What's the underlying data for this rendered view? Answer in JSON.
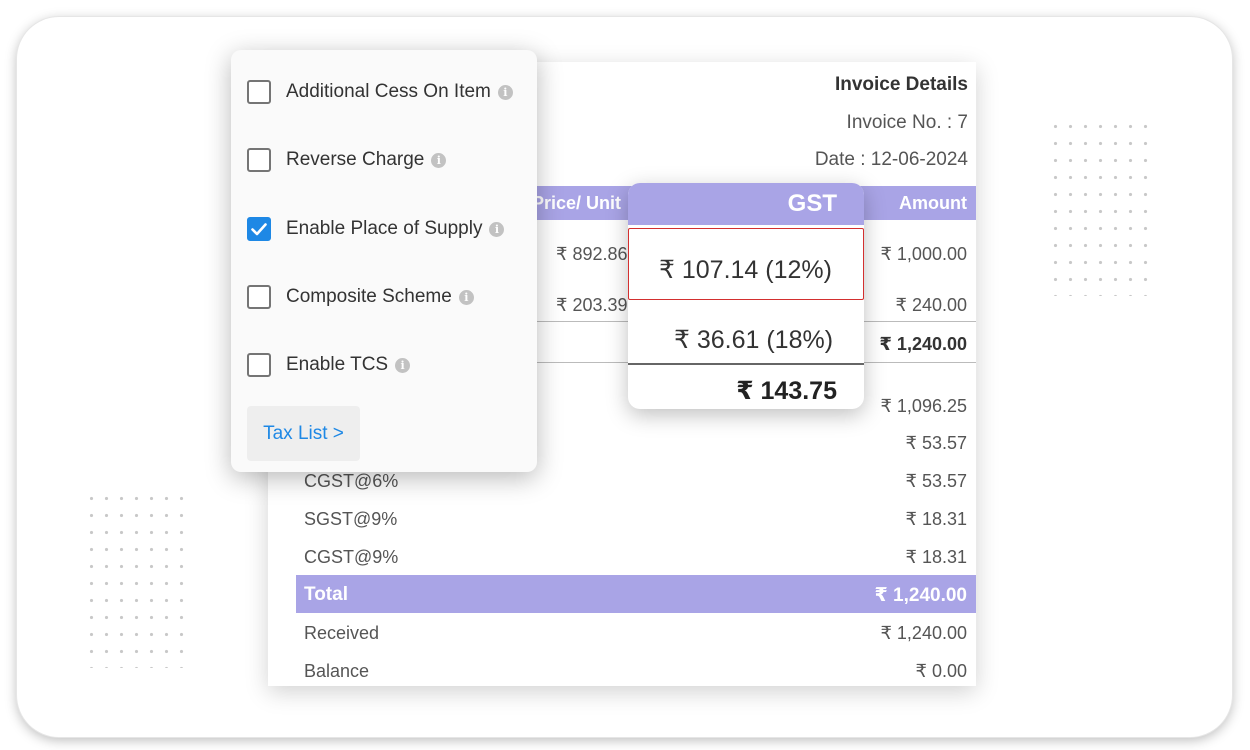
{
  "invoice": {
    "title": "Invoice Details",
    "number": "Invoice No. : 7",
    "date": "Date : 12-06-2024",
    "columns": {
      "price_unit": "Price/ Unit",
      "amount": "Amount"
    },
    "items": [
      {
        "price": "₹ 892.86",
        "amount": "₹ 1,000.00"
      },
      {
        "price": "₹ 203.39",
        "amount": "₹ 240.00"
      }
    ],
    "items_total": "₹ 1,240.00",
    "summary": [
      {
        "label": "",
        "value": "₹ 1,096.25"
      },
      {
        "label": "",
        "value": "₹ 53.57"
      },
      {
        "label": "CGST@6%",
        "value": "₹ 53.57"
      },
      {
        "label": "SGST@9%",
        "value": "₹ 18.31"
      },
      {
        "label": "CGST@9%",
        "value": "₹ 18.31"
      }
    ],
    "total": {
      "label": "Total",
      "value": "₹ 1,240.00"
    },
    "received": {
      "label": "Received",
      "value": "₹ 1,240.00"
    },
    "balance": {
      "label": "Balance",
      "value": "₹ 0.00"
    }
  },
  "gst_popup": {
    "header": "GST",
    "rows": [
      "₹ 107.14 (12%)",
      "₹ 36.61 (18%)"
    ],
    "total": "₹ 143.75"
  },
  "settings": {
    "options": [
      {
        "label": "Additional Cess On Item",
        "checked": false
      },
      {
        "label": "Reverse Charge",
        "checked": false
      },
      {
        "label": "Enable Place of Supply",
        "checked": true
      },
      {
        "label": "Composite Scheme",
        "checked": false
      },
      {
        "label": "Enable TCS",
        "checked": false
      }
    ],
    "tax_list_link": "Tax List >"
  },
  "icons": {
    "info": "info-icon",
    "check": "checkmark-icon"
  },
  "colors": {
    "accent": "#a9a4e6",
    "checkbox": "#1e88e5",
    "highlight": "#d32f2f",
    "link": "#1e88e5"
  }
}
